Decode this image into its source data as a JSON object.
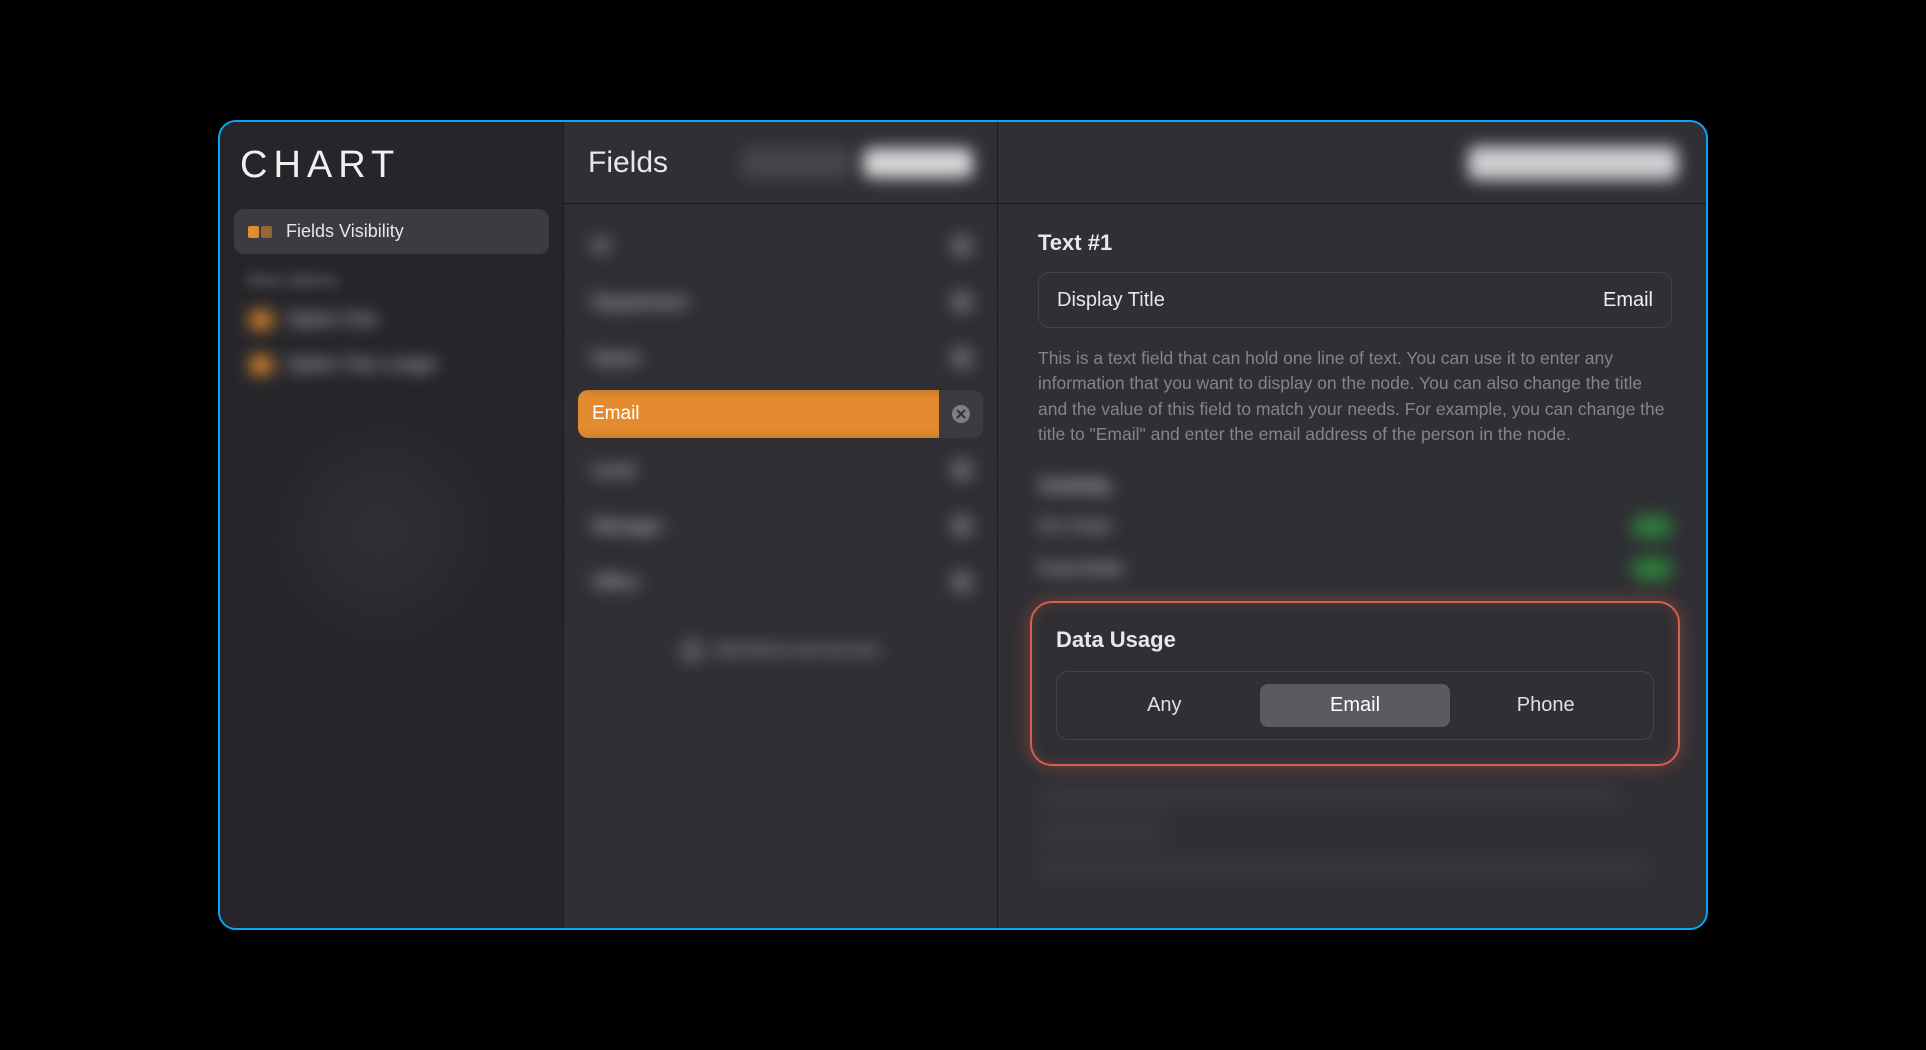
{
  "sidebar": {
    "title": "CHART",
    "items": [
      {
        "label": "Fields Visibility",
        "active": true
      },
      {
        "label": "Option One",
        "active": false
      },
      {
        "label": "Option Two Longer",
        "active": false
      }
    ],
    "group_label": "More Options"
  },
  "middle": {
    "title": "Fields",
    "fields": [
      {
        "label": "ID"
      },
      {
        "label": "Department"
      },
      {
        "label": "Name"
      },
      {
        "label": "Email",
        "selected": true
      },
      {
        "label": "Level"
      },
      {
        "label": "Manager"
      },
      {
        "label": "Office"
      }
    ],
    "footer_text": "Add field to the list here"
  },
  "right": {
    "section_title": "Text #1",
    "display_title_label": "Display Title",
    "display_title_value": "Email",
    "description": "This is a text field that can hold one line of text. You can use it to enter any information that you want to display on the node. You can also change the title and the value of this field to match your needs. For example, you can change the title to \"Email\" and enter the email address of the person in the node.",
    "options_header": "Visibility",
    "options": [
      {
        "label": "On Chart"
      },
      {
        "label": "Exportable"
      }
    ],
    "data_usage": {
      "title": "Data Usage",
      "segments": [
        "Any",
        "Email",
        "Phone"
      ],
      "active": "Email"
    }
  }
}
